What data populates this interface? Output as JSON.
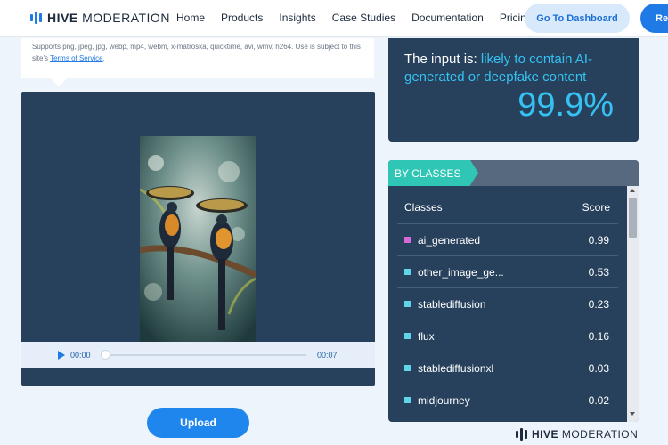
{
  "header": {
    "brand_bold": "HIVE",
    "brand_light": " MODERATION",
    "nav": [
      "Home",
      "Products",
      "Insights",
      "Case Studies",
      "Documentation",
      "Pricing"
    ],
    "dashboard_label": "Go To Dashboard",
    "request_label": "Re"
  },
  "upload": {
    "supports_text": "Supports png, jpeg, jpg, webp, mp4, webm, x-matroska, quicktime, avi, wmv, h264. Use is subject to this site's ",
    "terms_link": "Terms of Service",
    "terms_tail": ".",
    "current_time": "00:00",
    "duration": "00:07",
    "upload_label": "Upload"
  },
  "result": {
    "prefix": "The input is: ",
    "verdict": "likely to contain AI-generated or deepfake content",
    "score": "99.9%"
  },
  "classes": {
    "tab_label": "BY CLASSES",
    "col_classes": "Classes",
    "col_score": "Score",
    "rows": [
      {
        "name": "ai_generated",
        "score": "0.99",
        "color": "#d46ad8"
      },
      {
        "name": "other_image_ge...",
        "score": "0.53",
        "color": "#5fd6ea"
      },
      {
        "name": "stablediffusion",
        "score": "0.23",
        "color": "#5fd6ea"
      },
      {
        "name": "flux",
        "score": "0.16",
        "color": "#5fd6ea"
      },
      {
        "name": "stablediffusionxl",
        "score": "0.03",
        "color": "#5fd6ea"
      },
      {
        "name": "midjourney",
        "score": "0.02",
        "color": "#5fd6ea"
      }
    ]
  },
  "footer": {
    "brand_bold": "HIVE",
    "brand_light": " MODERATION"
  },
  "colors": {
    "accent": "#1f7ae6",
    "panel": "#27415c",
    "highlight": "#35c2f2",
    "tag": "#2fc6b5"
  }
}
